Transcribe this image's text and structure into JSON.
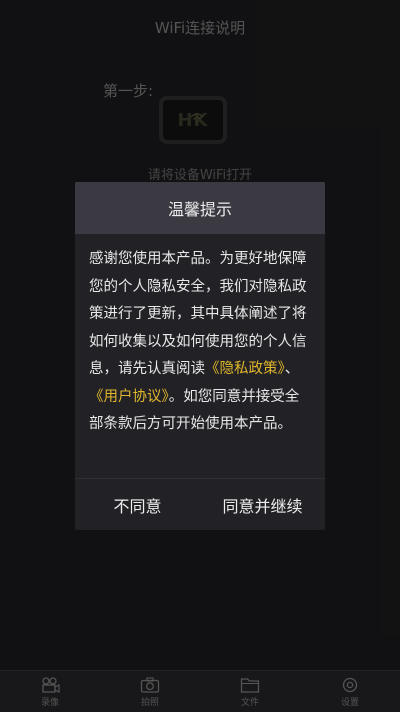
{
  "header": {
    "title": "WiFi连接说明"
  },
  "step": {
    "label": "第一步:",
    "device_text": "HK",
    "description": "请将设备WiFi打开"
  },
  "dialog": {
    "title": "温馨提示",
    "body_1": "感谢您使用本产品。为更好地保障您的个人隐私安全，我们对隐私政策进行了更新，其中具体阐述了将如何收集以及如何使用您的个人信息，请先认真阅读",
    "link_privacy": "《隐私政策》",
    "separator": "、",
    "link_agreement": "《用户协议》",
    "body_2": "。如您同意并接受全部条款后方可开始使用本产品。",
    "disagree_label": "不同意",
    "agree_label": "同意并继续",
    "link_color": "#e0b62c"
  },
  "tabbar": {
    "items": [
      {
        "label": "录像",
        "icon": "video-camera-icon"
      },
      {
        "label": "拍照",
        "icon": "photo-camera-icon"
      },
      {
        "label": "文件",
        "icon": "folder-icon"
      },
      {
        "label": "设置",
        "icon": "gear-icon"
      }
    ]
  }
}
